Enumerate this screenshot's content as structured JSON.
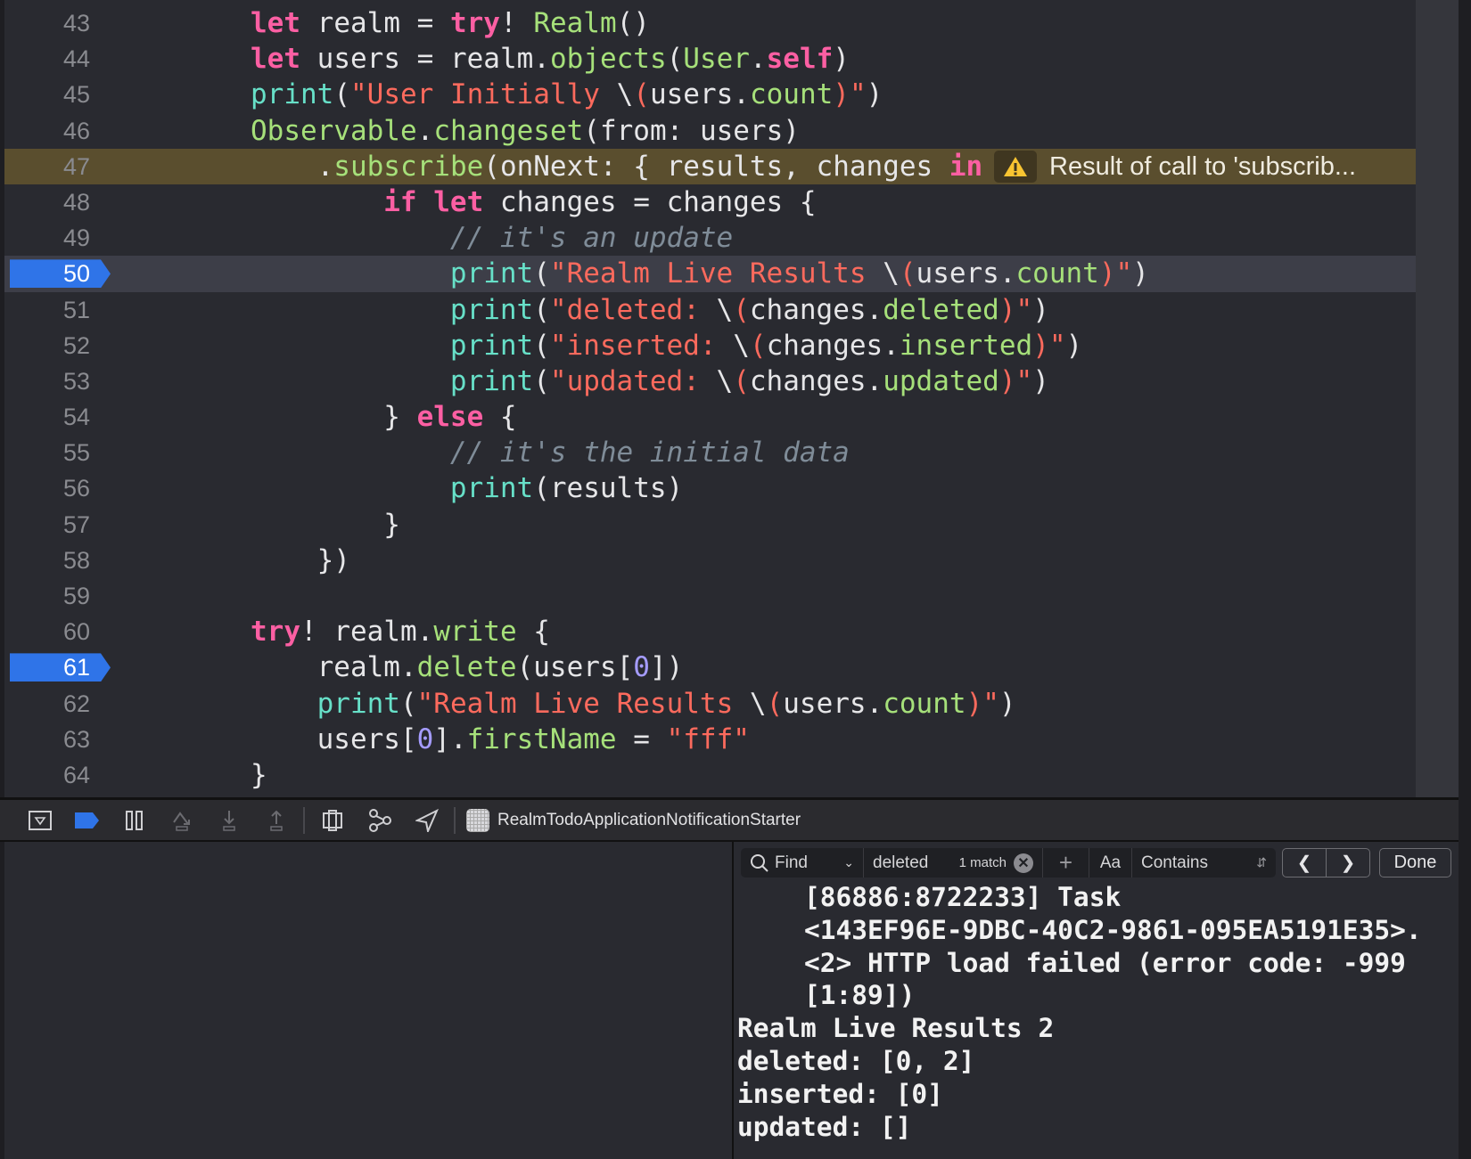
{
  "editor": {
    "lines": [
      {
        "n": "43",
        "indent": 0,
        "t": [
          [
            "kw",
            "let"
          ],
          [
            "",
            " realm = "
          ],
          [
            "kw",
            "try"
          ],
          [
            "",
            "! "
          ],
          [
            "gr",
            "Realm"
          ],
          [
            "",
            "()"
          ]
        ]
      },
      {
        "n": "44",
        "indent": 0,
        "t": [
          [
            "kw",
            "let"
          ],
          [
            "",
            " users = realm."
          ],
          [
            "gr",
            "objects"
          ],
          [
            "",
            "("
          ],
          [
            "gr",
            "User"
          ],
          [
            "",
            "."
          ],
          [
            "kw",
            "self"
          ],
          [
            "",
            ")"
          ]
        ]
      },
      {
        "n": "45",
        "indent": 0,
        "t": [
          [
            "fn",
            "print"
          ],
          [
            "",
            "("
          ],
          [
            "str",
            "\"User Initially "
          ],
          [
            "",
            "\\"
          ],
          [
            "str",
            "("
          ],
          [
            "",
            "users."
          ],
          [
            "gr",
            "count"
          ],
          [
            "str",
            ")\""
          ],
          [
            "",
            ")"
          ]
        ]
      },
      {
        "n": "46",
        "indent": 0,
        "t": [
          [
            "gr",
            "Observable"
          ],
          [
            "",
            "."
          ],
          [
            "gr",
            "changeset"
          ],
          [
            "",
            "(from: users)"
          ]
        ]
      },
      {
        "n": "47",
        "indent": 4,
        "warn": true,
        "t": [
          [
            "",
            "."
          ],
          [
            "gr",
            "subscribe"
          ],
          [
            "",
            "(onNext: { results, changes "
          ],
          [
            "kw",
            "in"
          ]
        ]
      },
      {
        "n": "48",
        "indent": 8,
        "t": [
          [
            "kw",
            "if"
          ],
          [
            "",
            " "
          ],
          [
            "kw",
            "let"
          ],
          [
            "",
            " changes = changes {"
          ]
        ]
      },
      {
        "n": "49",
        "indent": 12,
        "t": [
          [
            "cm",
            "// it's an update"
          ]
        ]
      },
      {
        "n": "50",
        "indent": 12,
        "cur": true,
        "bp": true,
        "t": [
          [
            "fn",
            "print"
          ],
          [
            "",
            "("
          ],
          [
            "str",
            "\"Realm Live Results "
          ],
          [
            "",
            "\\"
          ],
          [
            "str",
            "("
          ],
          [
            "",
            "users."
          ],
          [
            "gr",
            "count"
          ],
          [
            "str",
            ")\""
          ],
          [
            "",
            ")"
          ]
        ]
      },
      {
        "n": "51",
        "indent": 12,
        "t": [
          [
            "fn",
            "print"
          ],
          [
            "",
            "("
          ],
          [
            "str",
            "\"deleted: "
          ],
          [
            "",
            "\\"
          ],
          [
            "str",
            "("
          ],
          [
            "",
            "changes."
          ],
          [
            "gr",
            "deleted"
          ],
          [
            "str",
            ")\""
          ],
          [
            "",
            ")"
          ]
        ]
      },
      {
        "n": "52",
        "indent": 12,
        "t": [
          [
            "fn",
            "print"
          ],
          [
            "",
            "("
          ],
          [
            "str",
            "\"inserted: "
          ],
          [
            "",
            "\\"
          ],
          [
            "str",
            "("
          ],
          [
            "",
            "changes."
          ],
          [
            "gr",
            "inserted"
          ],
          [
            "str",
            ")\""
          ],
          [
            "",
            ")"
          ]
        ]
      },
      {
        "n": "53",
        "indent": 12,
        "t": [
          [
            "fn",
            "print"
          ],
          [
            "",
            "("
          ],
          [
            "str",
            "\"updated: "
          ],
          [
            "",
            "\\"
          ],
          [
            "str",
            "("
          ],
          [
            "",
            "changes."
          ],
          [
            "gr",
            "updated"
          ],
          [
            "str",
            ")\""
          ],
          [
            "",
            ")"
          ]
        ]
      },
      {
        "n": "54",
        "indent": 8,
        "t": [
          [
            "",
            "} "
          ],
          [
            "kw",
            "else"
          ],
          [
            "",
            " {"
          ]
        ]
      },
      {
        "n": "55",
        "indent": 12,
        "t": [
          [
            "cm",
            "// it's the initial data"
          ]
        ]
      },
      {
        "n": "56",
        "indent": 12,
        "t": [
          [
            "fn",
            "print"
          ],
          [
            "",
            "(results)"
          ]
        ]
      },
      {
        "n": "57",
        "indent": 8,
        "t": [
          [
            "",
            "}"
          ]
        ]
      },
      {
        "n": "58",
        "indent": 4,
        "t": [
          [
            "",
            "})"
          ]
        ]
      },
      {
        "n": "59",
        "indent": 0,
        "t": []
      },
      {
        "n": "60",
        "indent": 0,
        "t": [
          [
            "kw",
            "try"
          ],
          [
            "",
            "! realm."
          ],
          [
            "gr",
            "write"
          ],
          [
            "",
            " {"
          ]
        ]
      },
      {
        "n": "61",
        "indent": 4,
        "bp": true,
        "t": [
          [
            "",
            "realm."
          ],
          [
            "gr",
            "delete"
          ],
          [
            "",
            "(users["
          ],
          [
            "num",
            "0"
          ],
          [
            "",
            "])"
          ]
        ]
      },
      {
        "n": "62",
        "indent": 4,
        "t": [
          [
            "fn",
            "print"
          ],
          [
            "",
            "("
          ],
          [
            "str",
            "\"Realm Live Results "
          ],
          [
            "",
            "\\"
          ],
          [
            "str",
            "("
          ],
          [
            "",
            "users."
          ],
          [
            "gr",
            "count"
          ],
          [
            "str",
            ")\""
          ],
          [
            "",
            ")"
          ]
        ]
      },
      {
        "n": "63",
        "indent": 4,
        "t": [
          [
            "",
            "users["
          ],
          [
            "num",
            "0"
          ],
          [
            "",
            "]."
          ],
          [
            "gr",
            "firstName"
          ],
          [
            "",
            " = "
          ],
          [
            "str",
            "\"fff\""
          ]
        ]
      },
      {
        "n": "64",
        "indent": 0,
        "t": [
          [
            "",
            "}"
          ]
        ]
      }
    ],
    "warning": "Result of call to 'subscrib..."
  },
  "toolbar": {
    "scheme": "RealmTodoApplicationNotificationStarter"
  },
  "find": {
    "mode": "Find",
    "query": "deleted",
    "matches": "1 match",
    "case_label": "Aa",
    "match_type": "Contains",
    "done": "Done"
  },
  "console": {
    "lines": [
      {
        "text": "[86886:8722233] Task",
        "indent": true
      },
      {
        "text": "<143EF96E-9DBC-40C2-9861-095EA5191E35>.",
        "indent": true
      },
      {
        "text": "<2> HTTP load failed (error code: -999",
        "indent": true
      },
      {
        "text": "[1:89])",
        "indent": true
      },
      {
        "text": "Realm Live Results 2",
        "indent": false
      },
      {
        "text": "deleted: [0, 2]",
        "indent": false
      },
      {
        "text": "inserted: [0]",
        "indent": false
      },
      {
        "text": "updated: []",
        "indent": false
      }
    ]
  },
  "colors": {
    "accent": "#2f74e8",
    "warning": "#5a4e2e",
    "keyword": "#fc5fa3",
    "string": "#fc6a5d"
  }
}
